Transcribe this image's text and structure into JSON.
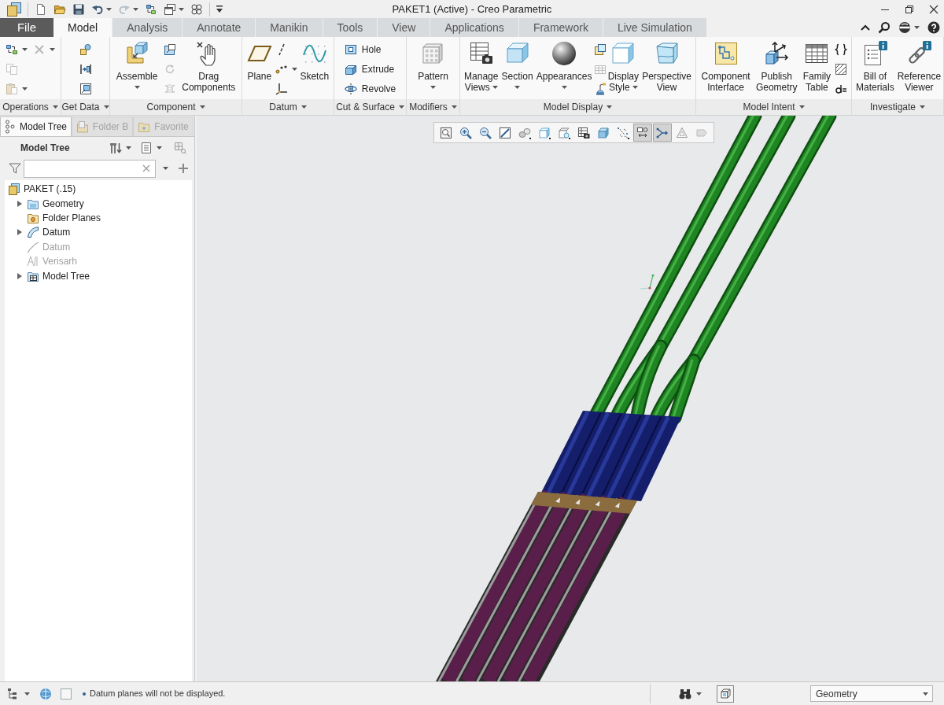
{
  "title_bar": {
    "quick_access": [
      {
        "caret": false,
        "disabled": false
      },
      {
        "caret": false,
        "disabled": false
      },
      {
        "caret": false,
        "disabled": false
      },
      {
        "caret": true,
        "disabled": false
      },
      {
        "caret": true,
        "disabled": true
      },
      {
        "caret": false,
        "disabled": false
      },
      {
        "caret": true,
        "disabled": false
      },
      {
        "caret": false,
        "disabled": false
      }
    ],
    "title": "PAKET1 (Active) - Creo Parametric"
  },
  "ribbon_tabs": [
    {
      "label": "File",
      "kind": "file",
      "selected": false
    },
    {
      "label": "Model",
      "kind": "tab",
      "selected": true
    },
    {
      "label": "Analysis",
      "kind": "tab",
      "selected": false
    },
    {
      "label": "Annotate",
      "kind": "tab",
      "selected": false
    },
    {
      "label": "Manikin",
      "kind": "tab",
      "selected": false
    },
    {
      "label": "Tools",
      "kind": "tab",
      "selected": false
    },
    {
      "label": "View",
      "kind": "tab",
      "selected": false
    },
    {
      "label": "Applications",
      "kind": "tab",
      "selected": false
    },
    {
      "label": "Framework",
      "kind": "tab",
      "selected": false
    },
    {
      "label": "Live Simulation",
      "kind": "tab",
      "selected": false
    }
  ],
  "ribbon": {
    "groups": [
      {
        "label": "Operations",
        "items": [
          {
            "kind": "column",
            "entries": [
              {
                "caret": true,
                "disabled": false
              },
              {
                "caret": false,
                "disabled": true
              },
              {
                "caret": true,
                "disabled": true
              }
            ]
          },
          {
            "kind": "column",
            "entries": [
              {
                "caret": true,
                "disabled": true
              }
            ]
          }
        ]
      },
      {
        "label": "Get Data",
        "items": [
          {
            "kind": "column",
            "entries": [
              {
                "caret": false,
                "disabled": false
              },
              {
                "caret": false,
                "disabled": false
              },
              {
                "caret": false,
                "disabled": false
              }
            ]
          }
        ]
      },
      {
        "label": "Component",
        "items": [
          {
            "kind": "split",
            "label": "Assemble",
            "disabled": false
          },
          {
            "kind": "column",
            "entries": [
              {
                "caret": false,
                "disabled": false
              },
              {
                "caret": false,
                "disabled": true
              },
              {
                "caret": false,
                "disabled": true
              }
            ]
          },
          {
            "kind": "large",
            "label": "Drag\nComponents",
            "caret": false,
            "disabled": false
          }
        ]
      },
      {
        "label": "Datum",
        "items": [
          {
            "kind": "large",
            "label": "Plane",
            "caret": false,
            "disabled": false
          },
          {
            "kind": "column",
            "entries": [
              {
                "caret": false,
                "disabled": false
              },
              {
                "caret": true,
                "disabled": false
              },
              {
                "caret": false,
                "disabled": false
              }
            ]
          },
          {
            "kind": "large",
            "label": "Sketch",
            "caret": false,
            "disabled": false
          }
        ]
      },
      {
        "label": "Cut & Surface",
        "items": [
          {
            "kind": "column",
            "entries": [
              {
                "label": "Hole",
                "caret": false,
                "disabled": false
              },
              {
                "label": "Extrude",
                "caret": false,
                "disabled": false
              },
              {
                "label": "Revolve",
                "caret": false,
                "disabled": false
              }
            ]
          }
        ]
      },
      {
        "label": "Modifiers",
        "items": [
          {
            "kind": "split",
            "label": "Pattern",
            "disabled": false
          }
        ]
      },
      {
        "label": "Model Display",
        "items": [
          {
            "kind": "large",
            "label": "Manage\nViews",
            "caret": true,
            "disabled": false
          },
          {
            "kind": "split",
            "label": "Section",
            "disabled": false
          },
          {
            "kind": "split",
            "label": "Appearances",
            "disabled": false
          },
          {
            "kind": "column",
            "entries": [
              {
                "caret": false,
                "disabled": false
              },
              {
                "caret": false,
                "disabled": true
              },
              {
                "caret": false,
                "disabled": false
              }
            ]
          },
          {
            "kind": "large",
            "label": "Display\nStyle",
            "caret": true,
            "disabled": false
          },
          {
            "kind": "large",
            "label": "Perspective\nView",
            "caret": false,
            "disabled": false
          }
        ]
      },
      {
        "label": "Model Intent",
        "items": [
          {
            "kind": "large",
            "label": "Component\nInterface",
            "caret": false,
            "disabled": false
          },
          {
            "kind": "large",
            "label": "Publish\nGeometry",
            "caret": false,
            "disabled": false
          },
          {
            "kind": "large",
            "label": "Family\nTable",
            "caret": false,
            "disabled": false
          },
          {
            "kind": "column",
            "entries": [
              {
                "caret": false,
                "disabled": false
              },
              {
                "caret": false,
                "disabled": false
              },
              {
                "caret": false,
                "disabled": false
              }
            ]
          }
        ]
      },
      {
        "label": "Investigate",
        "items": [
          {
            "kind": "large",
            "label": "Bill of\nMaterials",
            "caret": false,
            "disabled": false
          },
          {
            "kind": "large",
            "label": "Reference\nViewer",
            "caret": false,
            "disabled": false
          }
        ]
      }
    ]
  },
  "model_tree": {
    "tabs": [
      {
        "label": "Model Tree",
        "selected": true
      },
      {
        "label": "Folder B",
        "selected": false
      },
      {
        "label": "Favorite",
        "selected": false
      }
    ],
    "title": "Model Tree",
    "items": [
      {
        "label": "PAKET (.15)",
        "kind": "assembly",
        "collapsed": false,
        "disabled": false,
        "children": [
          {
            "label": "Geometry",
            "kind": "folder",
            "collapsed": true,
            "disabled": false
          },
          {
            "label": "Folder Planes",
            "kind": "planes-folder",
            "collapsed": false,
            "disabled": false
          },
          {
            "label": "Datum",
            "kind": "datum",
            "collapsed": true,
            "disabled": false
          },
          {
            "label": "Datum",
            "kind": "curve",
            "collapsed": false,
            "disabled": true
          },
          {
            "label": "Verisarh",
            "kind": "note",
            "collapsed": false,
            "disabled": true
          },
          {
            "label": "Model Tree",
            "kind": "tree-folder",
            "collapsed": true,
            "disabled": false
          }
        ]
      }
    ]
  },
  "view_toolbar": [
    {
      "flyout": false,
      "on": false
    },
    {
      "flyout": false,
      "on": false
    },
    {
      "flyout": false,
      "on": false
    },
    {
      "flyout": false,
      "on": false
    },
    {
      "flyout": true,
      "on": false
    },
    {
      "flyout": true,
      "on": false
    },
    {
      "flyout": true,
      "on": false
    },
    {
      "flyout": false,
      "on": false
    },
    {
      "flyout": false,
      "on": false
    },
    {
      "flyout": true,
      "on": false
    },
    {
      "flyout": false,
      "on": true
    },
    {
      "flyout": false,
      "on": true
    },
    {
      "flyout": false,
      "on": false
    },
    {
      "flyout": false,
      "on": false
    }
  ],
  "status_bar": {
    "message": "Datum planes will not be displayed.",
    "filter": "Geometry"
  }
}
